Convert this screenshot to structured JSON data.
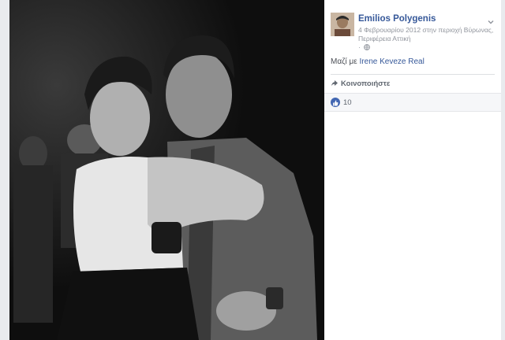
{
  "post": {
    "author": "Emilios Polygenis",
    "date_location": "4 Φεβρουαρίου 2012 στην περιοχή Βύρωνας, Περιφέρεια Αττική",
    "separator": "·",
    "tag_prefix": "Μαζί με",
    "tagged_person": "Irene Keveze Real",
    "share_label": "Κοινοποιήστε",
    "like_count": "10"
  },
  "colors": {
    "link": "#365899",
    "like": "#4267b2",
    "page_bg": "#e9ebee"
  },
  "icons": [
    "globe-icon",
    "chevron-down-icon",
    "share-icon",
    "like-icon"
  ]
}
